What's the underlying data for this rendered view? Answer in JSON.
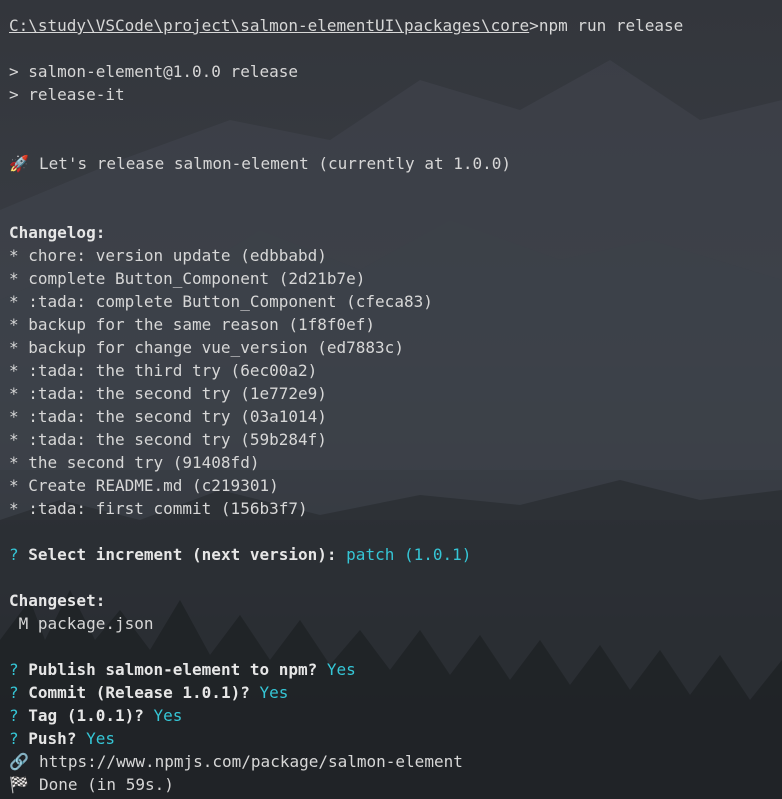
{
  "terminal": {
    "command_line": {
      "path": "C:\\study\\VSCode\\project\\salmon-elementUI\\packages\\core",
      "gt": ">",
      "command": "npm run release"
    },
    "script_header": [
      "> salmon-element@1.0.0 release",
      "> release-it"
    ],
    "release_intro": {
      "icon": "🚀",
      "text": "Let's release salmon-element (currently at 1.0.0)"
    },
    "changelog_label": "Changelog:",
    "changelog_entries": [
      "* chore: version update (edbbabd)",
      "* complete Button_Component (2d21b7e)",
      "* :tada: complete Button_Component (cfeca83)",
      "* backup for the same reason (1f8f0ef)",
      "* backup for change vue_version (ed7883c)",
      "* :tada: the third try (6ec00a2)",
      "* :tada: the second try (1e772e9)",
      "* :tada: the second try (03a1014)",
      "* :tada: the second try (59b284f)",
      "* the second try (91408fd)",
      "* Create README.md (c219301)",
      "* :tada: first commit (156b3f7)"
    ],
    "select_increment": {
      "mark": "?",
      "question": "Select increment (next version):",
      "answer": "patch (1.0.1)"
    },
    "changeset_label": "Changeset:",
    "changeset_file": " M package.json",
    "prompts": [
      {
        "mark": "?",
        "question": "Publish salmon-element to npm?",
        "answer": "Yes"
      },
      {
        "mark": "?",
        "question": "Commit (Release 1.0.1)?",
        "answer": "Yes"
      },
      {
        "mark": "?",
        "question": "Tag (1.0.1)?",
        "answer": "Yes"
      },
      {
        "mark": "?",
        "question": "Push?",
        "answer": "Yes"
      }
    ],
    "package_link": {
      "icon": "🔗",
      "url": "https://www.npmjs.com/package/salmon-element"
    },
    "done": {
      "icon": "🏁",
      "text": "Done (in 59s.)"
    }
  },
  "colors": {
    "text": "#d7d7d7",
    "accent_cyan": "#35c6d6",
    "background": "#2c2f35"
  },
  "icons": {
    "rocket": "rocket-icon",
    "link": "link-icon",
    "checkered_flag": "checkered-flag-icon"
  }
}
